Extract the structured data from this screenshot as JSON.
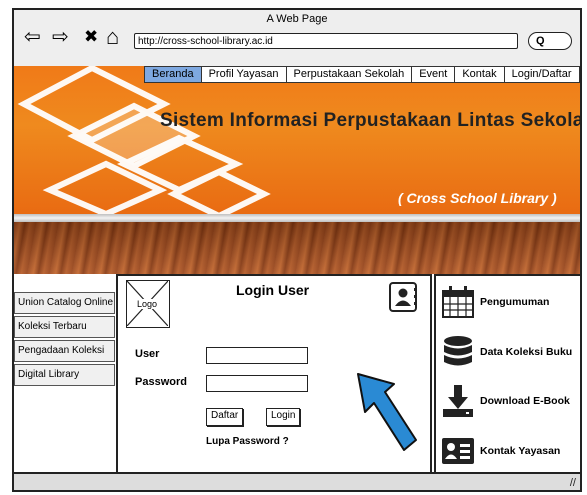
{
  "window": {
    "title": "A Web Page",
    "url": "http://cross-school-library.ac.id",
    "search_glyph": "Q"
  },
  "nav": {
    "back_glyph": "⇦",
    "forward_glyph": "⇨",
    "close_glyph": "✖",
    "home_glyph": "⌂"
  },
  "menu": {
    "items": [
      {
        "label": "Beranda",
        "active": true
      },
      {
        "label": "Profil Yayasan"
      },
      {
        "label": "Perpustakaan Sekolah"
      },
      {
        "label": "Event"
      },
      {
        "label": "Kontak"
      },
      {
        "label": "Login/Daftar"
      }
    ]
  },
  "header": {
    "title": "Sistem Informasi Perpustakaan Lintas Sekolah",
    "subtitle": "( Cross School Library )",
    "colors": {
      "orange": "#f07a18",
      "menu_active": "#7ea8e0"
    }
  },
  "sidebar": {
    "items": [
      {
        "label": "Union Catalog Online"
      },
      {
        "label": "Koleksi Terbaru"
      },
      {
        "label": "Pengadaan Koleksi"
      },
      {
        "label": "Digital Library"
      }
    ]
  },
  "login": {
    "logo_label": "Logo",
    "title": "Login User",
    "user_label": "User",
    "password_label": "Password",
    "user_value": "",
    "password_value": "",
    "daftar_button": "Daftar",
    "login_button": "Login",
    "forgot_link": "Lupa Password ?",
    "contact_icon": "contact-card-icon",
    "cursor_icon": "pointer-arrow-icon",
    "cursor_color": "#2a8ad4"
  },
  "right_panel": {
    "items": [
      {
        "label": "Pengumuman",
        "icon": "calendar-icon"
      },
      {
        "label": "Data Koleksi Buku",
        "icon": "database-icon"
      },
      {
        "label": "Download E-Book",
        "icon": "download-icon"
      },
      {
        "label": "Kontak Yayasan",
        "icon": "contact-card-icon"
      }
    ]
  },
  "statusbar": {
    "grip_glyph": "//"
  }
}
